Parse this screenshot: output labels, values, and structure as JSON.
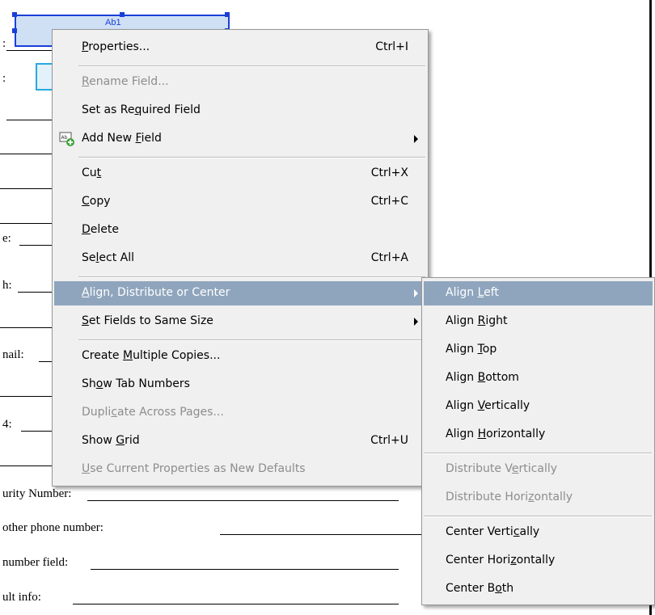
{
  "document": {
    "labels": [
      ":",
      ":",
      "e:",
      "h:",
      "nail:",
      "4:",
      "urity Number:",
      "other phone number:",
      "number field:",
      "ult info:"
    ],
    "field_tag": "Ab1"
  },
  "context_menu": {
    "items": [
      {
        "pre": "",
        "key": "P",
        "post": "roperties...",
        "shortcut": "Ctrl+I"
      },
      {
        "pre": "",
        "key": "R",
        "post": "ename Field..."
      },
      {
        "pre": "Set as Re",
        "key": "q",
        "post": "uired Field"
      },
      {
        "pre": "Add New ",
        "key": "F",
        "post": "ield"
      },
      {
        "pre": "Cu",
        "key": "t",
        "post": "",
        "shortcut": "Ctrl+X"
      },
      {
        "pre": "",
        "key": "C",
        "post": "opy",
        "shortcut": "Ctrl+C"
      },
      {
        "pre": "",
        "key": "D",
        "post": "elete"
      },
      {
        "pre": "Se",
        "key": "l",
        "post": "ect All",
        "shortcut": "Ctrl+A"
      },
      {
        "pre": "",
        "key": "A",
        "post": "lign, Distribute or Center"
      },
      {
        "pre": "",
        "key": "S",
        "post": "et Fields to Same Size"
      },
      {
        "pre": "Create ",
        "key": "M",
        "post": "ultiple Copies..."
      },
      {
        "pre": "Sh",
        "key": "o",
        "post": "w Tab Numbers"
      },
      {
        "pre": "Dupli",
        "key": "c",
        "post": "ate Across Pages..."
      },
      {
        "pre": "Show ",
        "key": "G",
        "post": "rid",
        "shortcut": "Ctrl+U"
      },
      {
        "pre": "",
        "key": "U",
        "post": "se Current Properties as New Defaults"
      }
    ]
  },
  "submenu": {
    "items": [
      {
        "pre": "Align ",
        "key": "L",
        "post": "eft"
      },
      {
        "pre": "Align ",
        "key": "R",
        "post": "ight"
      },
      {
        "pre": "Align ",
        "key": "T",
        "post": "op"
      },
      {
        "pre": "Align ",
        "key": "B",
        "post": "ottom"
      },
      {
        "pre": "Align ",
        "key": "V",
        "post": "ertically"
      },
      {
        "pre": "Align ",
        "key": "H",
        "post": "orizontally"
      },
      {
        "pre": "Distribute V",
        "key": "e",
        "post": "rtically"
      },
      {
        "pre": "Distribute Hori",
        "key": "z",
        "post": "ontally"
      },
      {
        "pre": "Center Verti",
        "key": "c",
        "post": "ally"
      },
      {
        "pre": "Center Hori",
        "key": "z",
        "post": "ontally"
      },
      {
        "pre": "Center B",
        "key": "o",
        "post": "th"
      }
    ]
  }
}
